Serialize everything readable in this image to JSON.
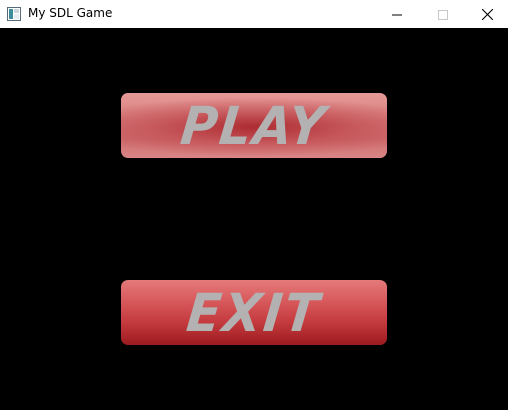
{
  "window": {
    "title": "My SDL Game"
  },
  "menu": {
    "play_label": "PLAY",
    "exit_label": "EXIT"
  },
  "colors": {
    "background": "#000000",
    "button_red": "#c43a3e",
    "label_gray": "#b3b1b1"
  }
}
